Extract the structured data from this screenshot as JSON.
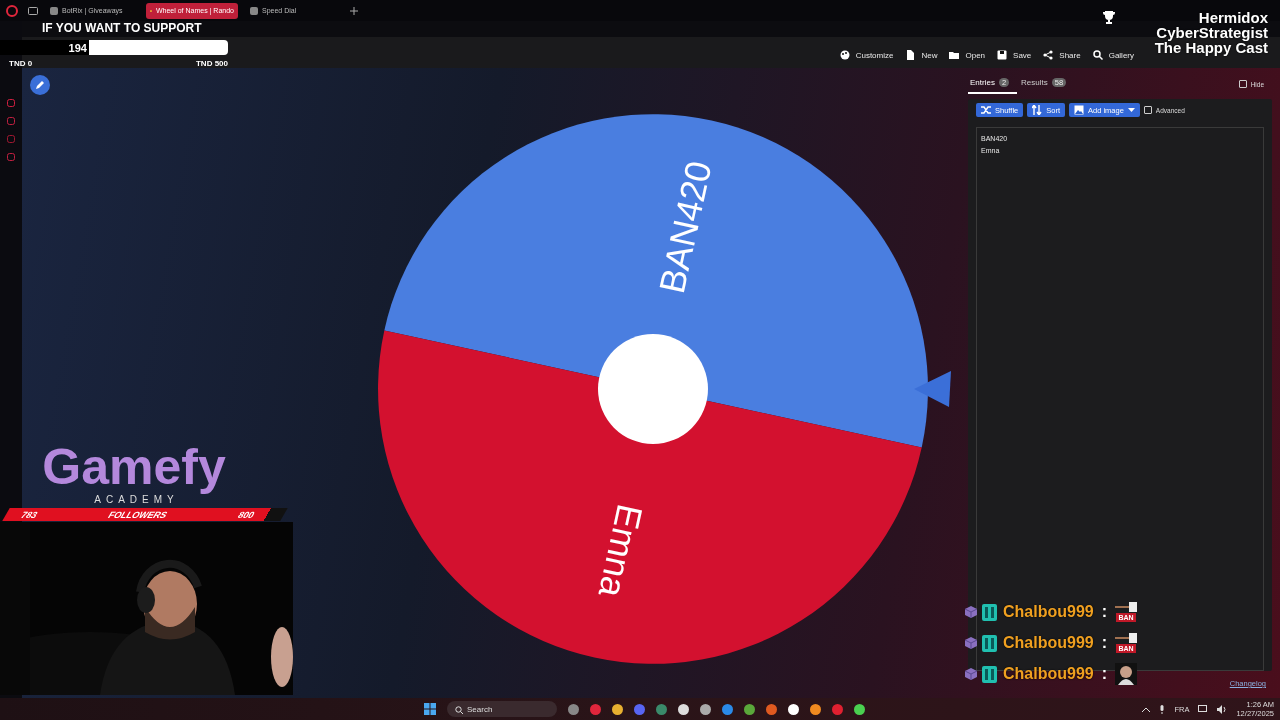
{
  "browser_tabs": [
    {
      "label": "BotRix | Giveaways",
      "selected": false
    },
    {
      "label": "Wheel of Names | Rando",
      "selected": true
    },
    {
      "label": "Speed Dial",
      "selected": false
    }
  ],
  "support_banner": {
    "title": "IF YOU WANT TO SUPPORT",
    "amount": "194",
    "level": 0.39,
    "min_label": "TND 0",
    "max_label": "TND 500"
  },
  "toolbar": [
    "Customize",
    "New",
    "Open",
    "Save",
    "Share",
    "Gallery"
  ],
  "streamer_names": [
    "Hermidox",
    "CyberStrategist",
    "The Happy Cast"
  ],
  "wheel": {
    "slices": [
      {
        "label": "BAN420",
        "color": "#4a7ee0"
      },
      {
        "label": "Emna",
        "color": "#d3112f"
      }
    ]
  },
  "panel": {
    "tabs": [
      {
        "label": "Entries",
        "count": "2",
        "selected": true
      },
      {
        "label": "Results",
        "count": "58",
        "selected": false
      }
    ],
    "hide": {
      "label": "Hide",
      "checked": false
    },
    "buttons": [
      "Shuffle",
      "Sort",
      "Add image"
    ],
    "advanced": {
      "label": "Advanced",
      "checked": false
    },
    "entries": [
      "BAN420",
      "Emna"
    ],
    "changelog": "Changelog"
  },
  "logo": {
    "name": "Gamefy",
    "tagline": "ACADEMY"
  },
  "followers": {
    "current": "783",
    "label": "FOLLOWERS",
    "goal": "800"
  },
  "chat": [
    {
      "user": "Chalbou999",
      "separator": ":",
      "kind": "ban",
      "badge": "BAN"
    },
    {
      "user": "Chalbou999",
      "separator": ":",
      "kind": "ban",
      "badge": "BAN"
    },
    {
      "user": "Chalbou999",
      "separator": ":",
      "kind": "face"
    }
  ],
  "taskbar": {
    "search_placeholder": "Search",
    "language": "FRA",
    "time": "1:26 AM",
    "date": "12/27/2025"
  }
}
